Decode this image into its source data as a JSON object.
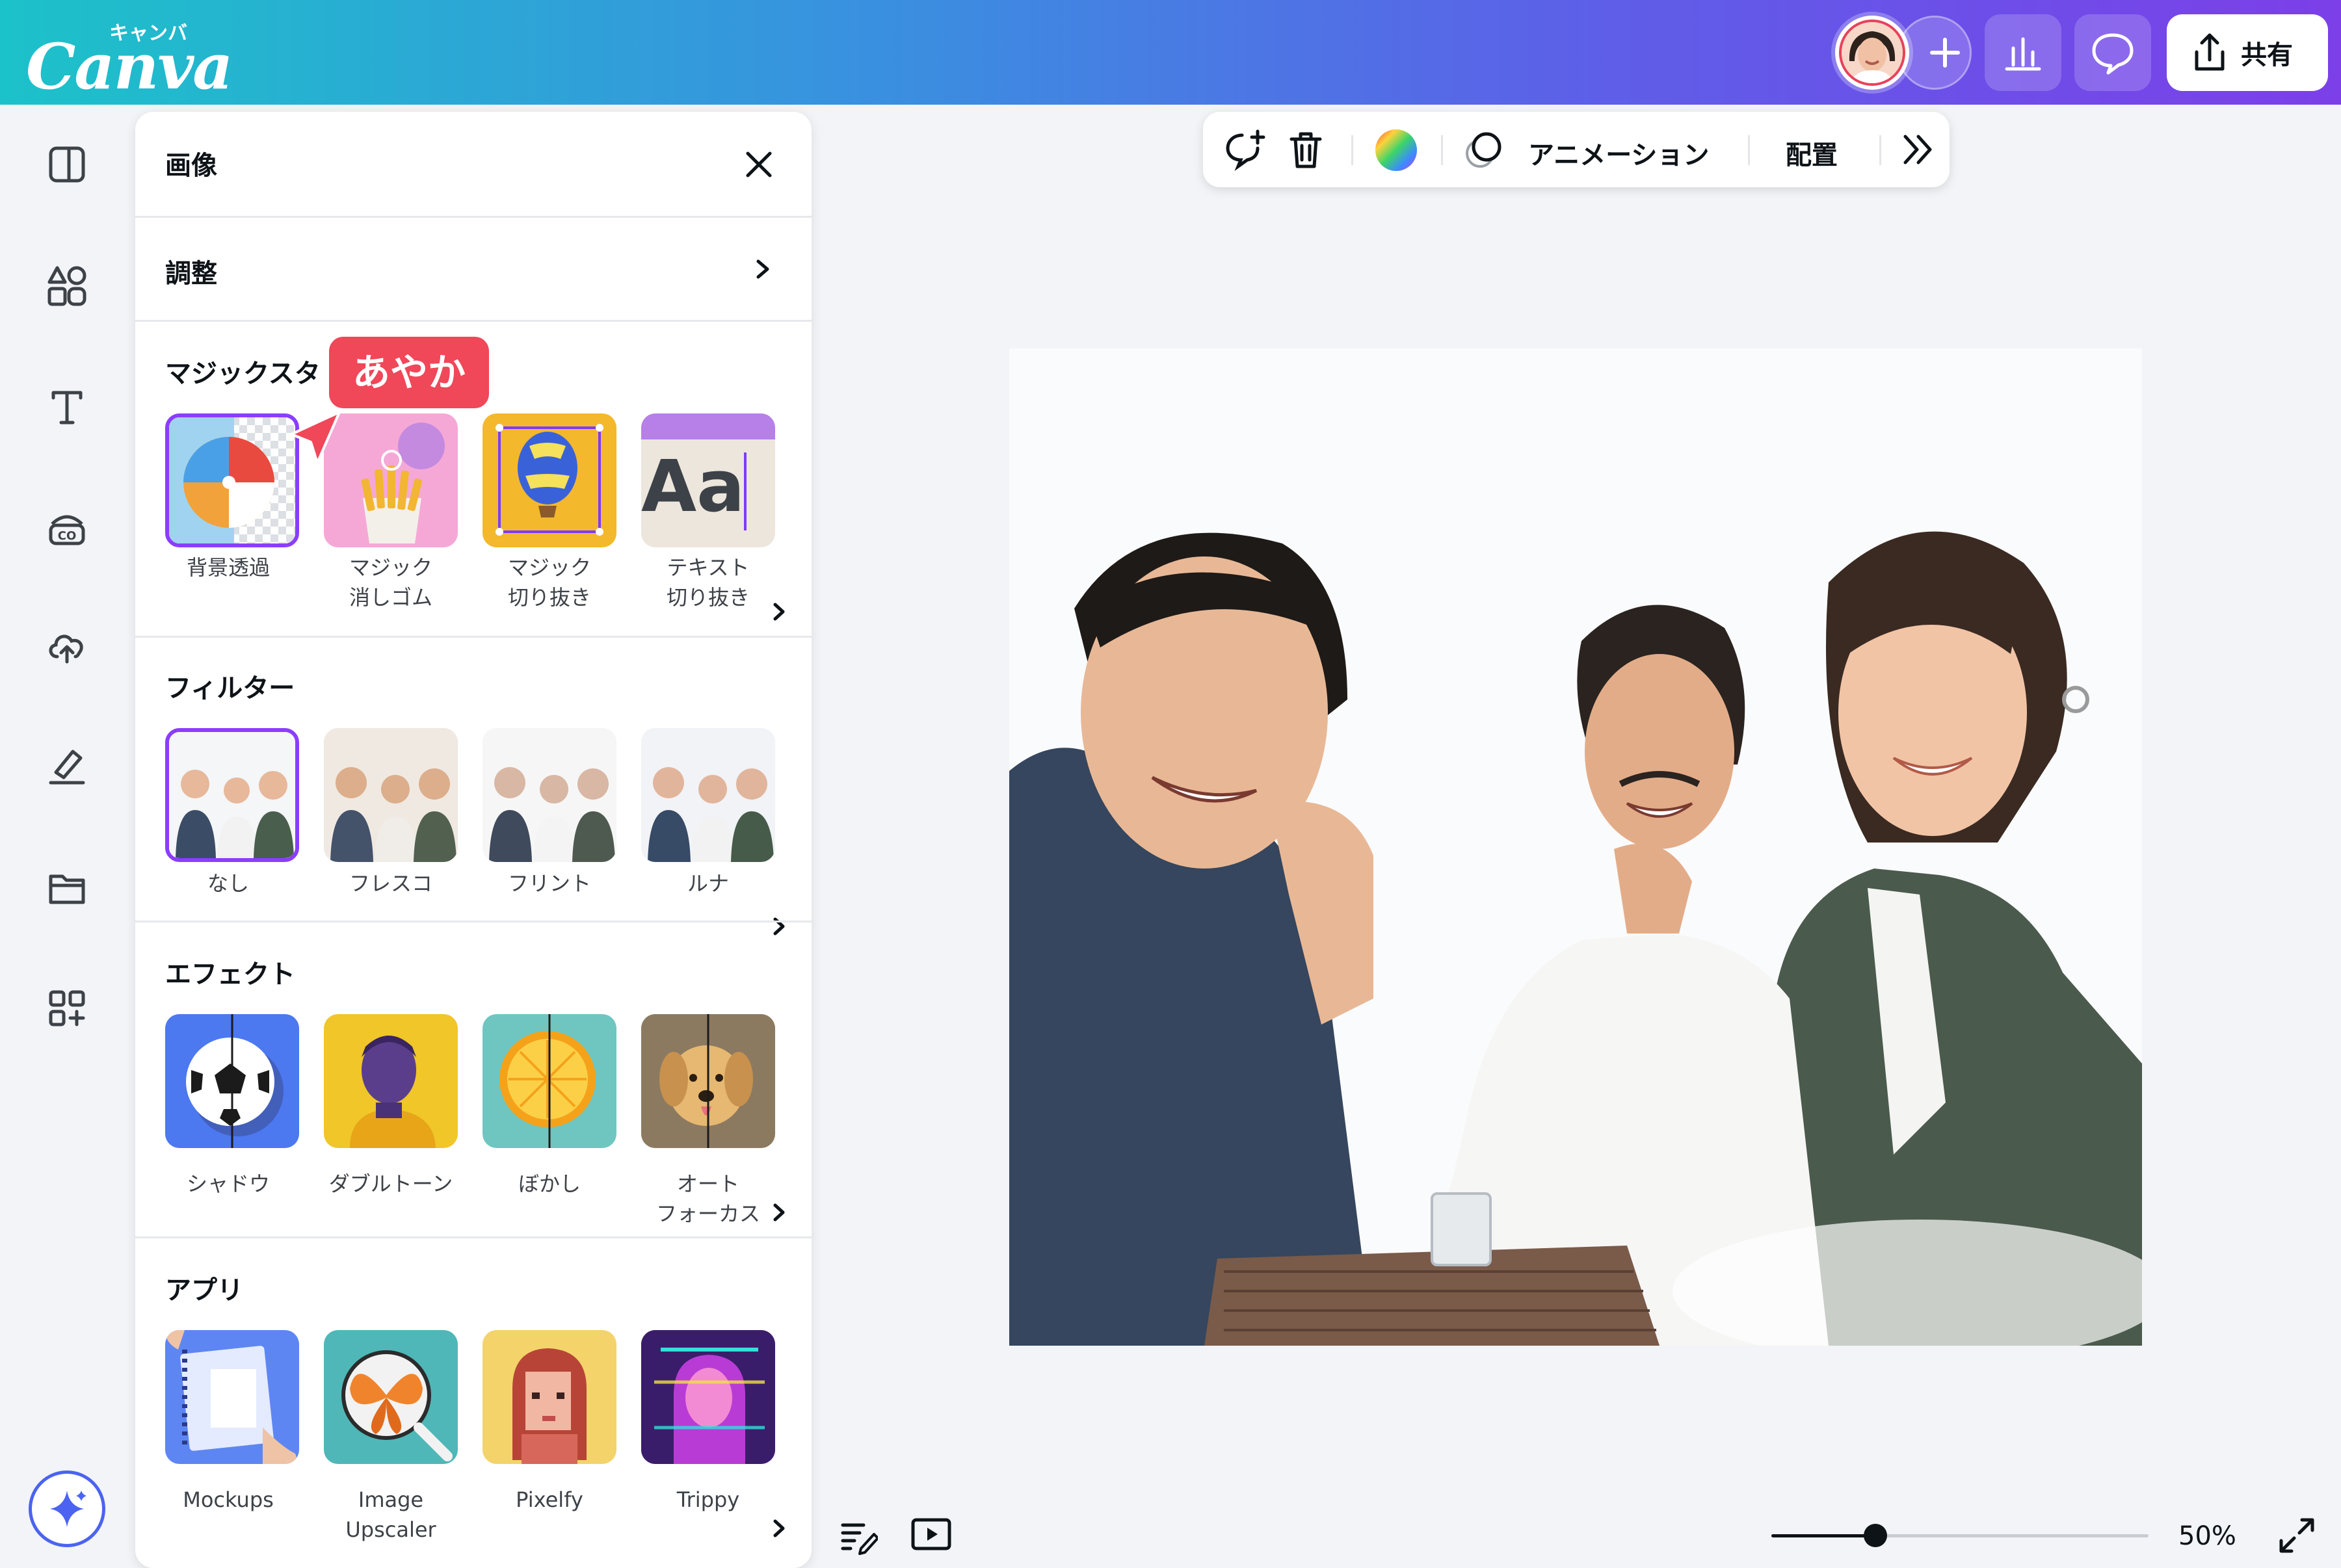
{
  "app": {
    "logo_text": "Canva",
    "logo_kana": "キャンバ",
    "share_label": "共有",
    "accent": "#8b3dff",
    "brand_gradient": [
      "#1cc2c9",
      "#7c3fe8"
    ]
  },
  "topbar_icons": [
    "avatar",
    "plus-icon",
    "insights-icon",
    "comment-icon",
    "share-icon"
  ],
  "rail": {
    "items": [
      "layout-icon",
      "elements-icon",
      "text-icon",
      "brand-icon",
      "uploads-icon",
      "draw-icon",
      "projects-icon",
      "apps-icon"
    ],
    "magic_icon": "sparkle-icon"
  },
  "panel": {
    "title": "画像",
    "adjust_label": "調整",
    "magic": {
      "title": "マジックスタ",
      "items": [
        {
          "label": "背景透過",
          "icon": "beach-ball"
        },
        {
          "label": "マジック\n消しゴム",
          "icon": "fries"
        },
        {
          "label": "マジック\n切り抜き",
          "icon": "balloon"
        },
        {
          "label": "テキスト\n切り抜き",
          "icon": "text-aa"
        }
      ]
    },
    "collaborator_badge": "あやか",
    "filters": {
      "title": "フィルター",
      "items": [
        {
          "label": "なし"
        },
        {
          "label": "フレスコ"
        },
        {
          "label": "フリント"
        },
        {
          "label": "ルナ"
        }
      ]
    },
    "effects": {
      "title": "エフェクト",
      "items": [
        {
          "label": "シャドウ"
        },
        {
          "label": "ダブルトーン"
        },
        {
          "label": "ぼかし"
        },
        {
          "label": "オート\nフォーカス"
        }
      ]
    },
    "apps": {
      "title": "アプリ",
      "items": [
        {
          "label": "Mockups"
        },
        {
          "label": "Image\nUpscaler"
        },
        {
          "label": "Pixelfy"
        },
        {
          "label": "Trippy"
        }
      ]
    }
  },
  "toolbar": {
    "animation_label": "アニメーション",
    "position_label": "配置",
    "icons": [
      "comment-add-icon",
      "trash-icon",
      "color-wheel-icon",
      "animation-icon",
      "more-icon"
    ]
  },
  "footer": {
    "zoom_label": "50%",
    "zoom_fraction": 0.5,
    "icons": [
      "notes-icon",
      "present-icon",
      "fullscreen-icon"
    ]
  }
}
